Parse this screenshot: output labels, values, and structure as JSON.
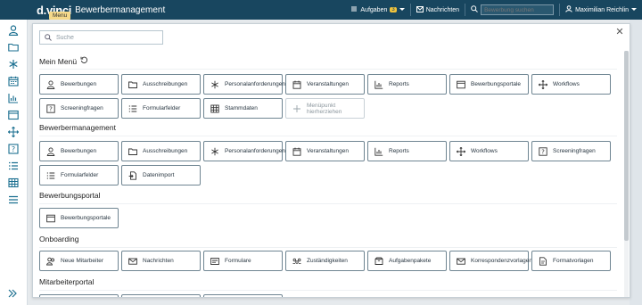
{
  "topbar": {
    "logo": "d.vinci",
    "app_title": "Bewerbermanagement",
    "tooltip": "Menu",
    "tasks_label": "Aufgaben",
    "tasks_count": "3",
    "messages_label": "Nachrichten",
    "search_placeholder": "Bewerbung suchen",
    "user_name": "Maximilian Reichlin"
  },
  "modal": {
    "search_placeholder": "Suche",
    "sections": {
      "mein_menu": {
        "title": "Mein Menü",
        "tiles": [
          "Bewerbungen",
          "Ausschreibungen",
          "Personalanforderungen",
          "Veranstaltungen",
          "Reports",
          "Bewerbungsportale",
          "Workflows",
          "Screeningfragen",
          "Formularfelder",
          "Stammdaten",
          "Menüpunkt hierherziehen"
        ]
      },
      "bewerbermanagement": {
        "title": "Bewerbermanagement",
        "tiles": [
          "Bewerbungen",
          "Ausschreibungen",
          "Personalanforderungen",
          "Veranstaltungen",
          "Reports",
          "Workflows",
          "Screeningfragen",
          "Formularfelder",
          "Datenimport"
        ]
      },
      "bewerbungsportal": {
        "title": "Bewerbungsportal",
        "tiles": [
          "Bewerbungsportale"
        ]
      },
      "onboarding": {
        "title": "Onboarding",
        "tiles": [
          "Neue Mitarbeiter",
          "Nachrichten",
          "Formulare",
          "Zuständigkeiten",
          "Aufgabenpakete",
          "Korrespondenzvorlagen",
          "Formatvorlagen"
        ]
      },
      "mitarbeiterportal": {
        "title": "Mitarbeiterportal"
      }
    }
  },
  "colors": {
    "topbar_bg": "#18465f",
    "sidebar_icon": "#1b6f90",
    "tile_border": "#6f8592"
  }
}
